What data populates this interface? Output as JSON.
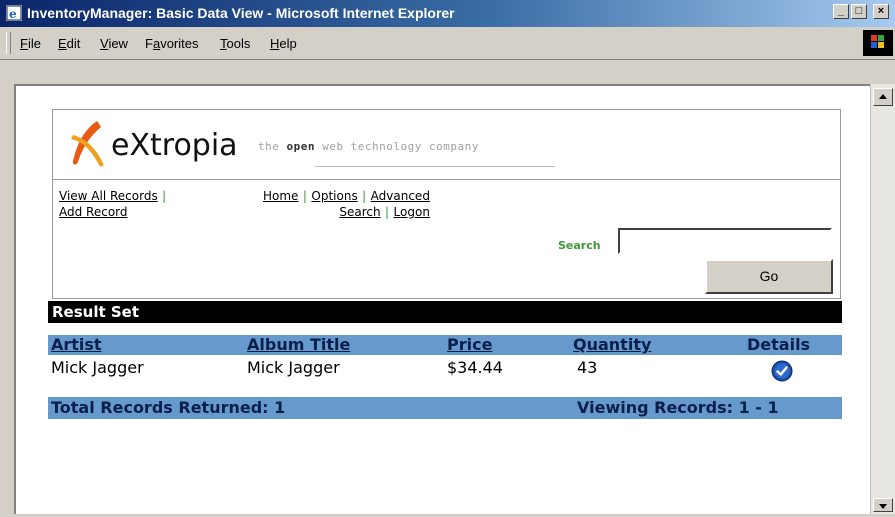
{
  "window": {
    "title": "InventoryManager: Basic Data View - Microsoft Internet Explorer",
    "controls": {
      "minimize": "_",
      "maximize": "□",
      "close": "×"
    }
  },
  "menu": {
    "items": [
      {
        "pre": "",
        "key": "F",
        "post": "ile"
      },
      {
        "pre": "",
        "key": "E",
        "post": "dit"
      },
      {
        "pre": "",
        "key": "V",
        "post": "iew"
      },
      {
        "pre": "F",
        "key": "a",
        "post": "vorites"
      },
      {
        "pre": "",
        "key": "T",
        "post": "ools"
      },
      {
        "pre": "",
        "key": "H",
        "post": "elp"
      }
    ]
  },
  "header": {
    "logo_text": "eXtropia",
    "tagline_pre": "the ",
    "tagline_bold": "open",
    "tagline_post": " web technology company"
  },
  "nav": {
    "view_all": "View All Records",
    "add_record": "Add Record",
    "home": "Home",
    "options": "Options",
    "advanced": "Advanced",
    "search": "Search",
    "logon": "Logon",
    "separator": "|"
  },
  "search": {
    "label": "Search",
    "value": "",
    "go_label": "Go"
  },
  "results": {
    "title": "Result Set",
    "columns": [
      "Artist",
      "Album Title",
      "Price",
      "Quantity",
      "Details"
    ],
    "rows": [
      {
        "artist": "Mick Jagger",
        "album": "Mick Jagger",
        "price": "$34.44",
        "quantity": "43"
      }
    ],
    "total_label": "Total Records Returned: 1",
    "viewing_label": "Viewing Records: 1 - 1"
  },
  "colors": {
    "title_bar": "#0a246a",
    "table_header": "#6699cc",
    "result_bar": "#000000",
    "separator_green": "#3a9a3a"
  },
  "icons": [
    "ie-icon",
    "windows-logo-icon",
    "extropia-logo-icon",
    "check-circle-icon",
    "scroll-up-icon",
    "scroll-down-icon"
  ]
}
